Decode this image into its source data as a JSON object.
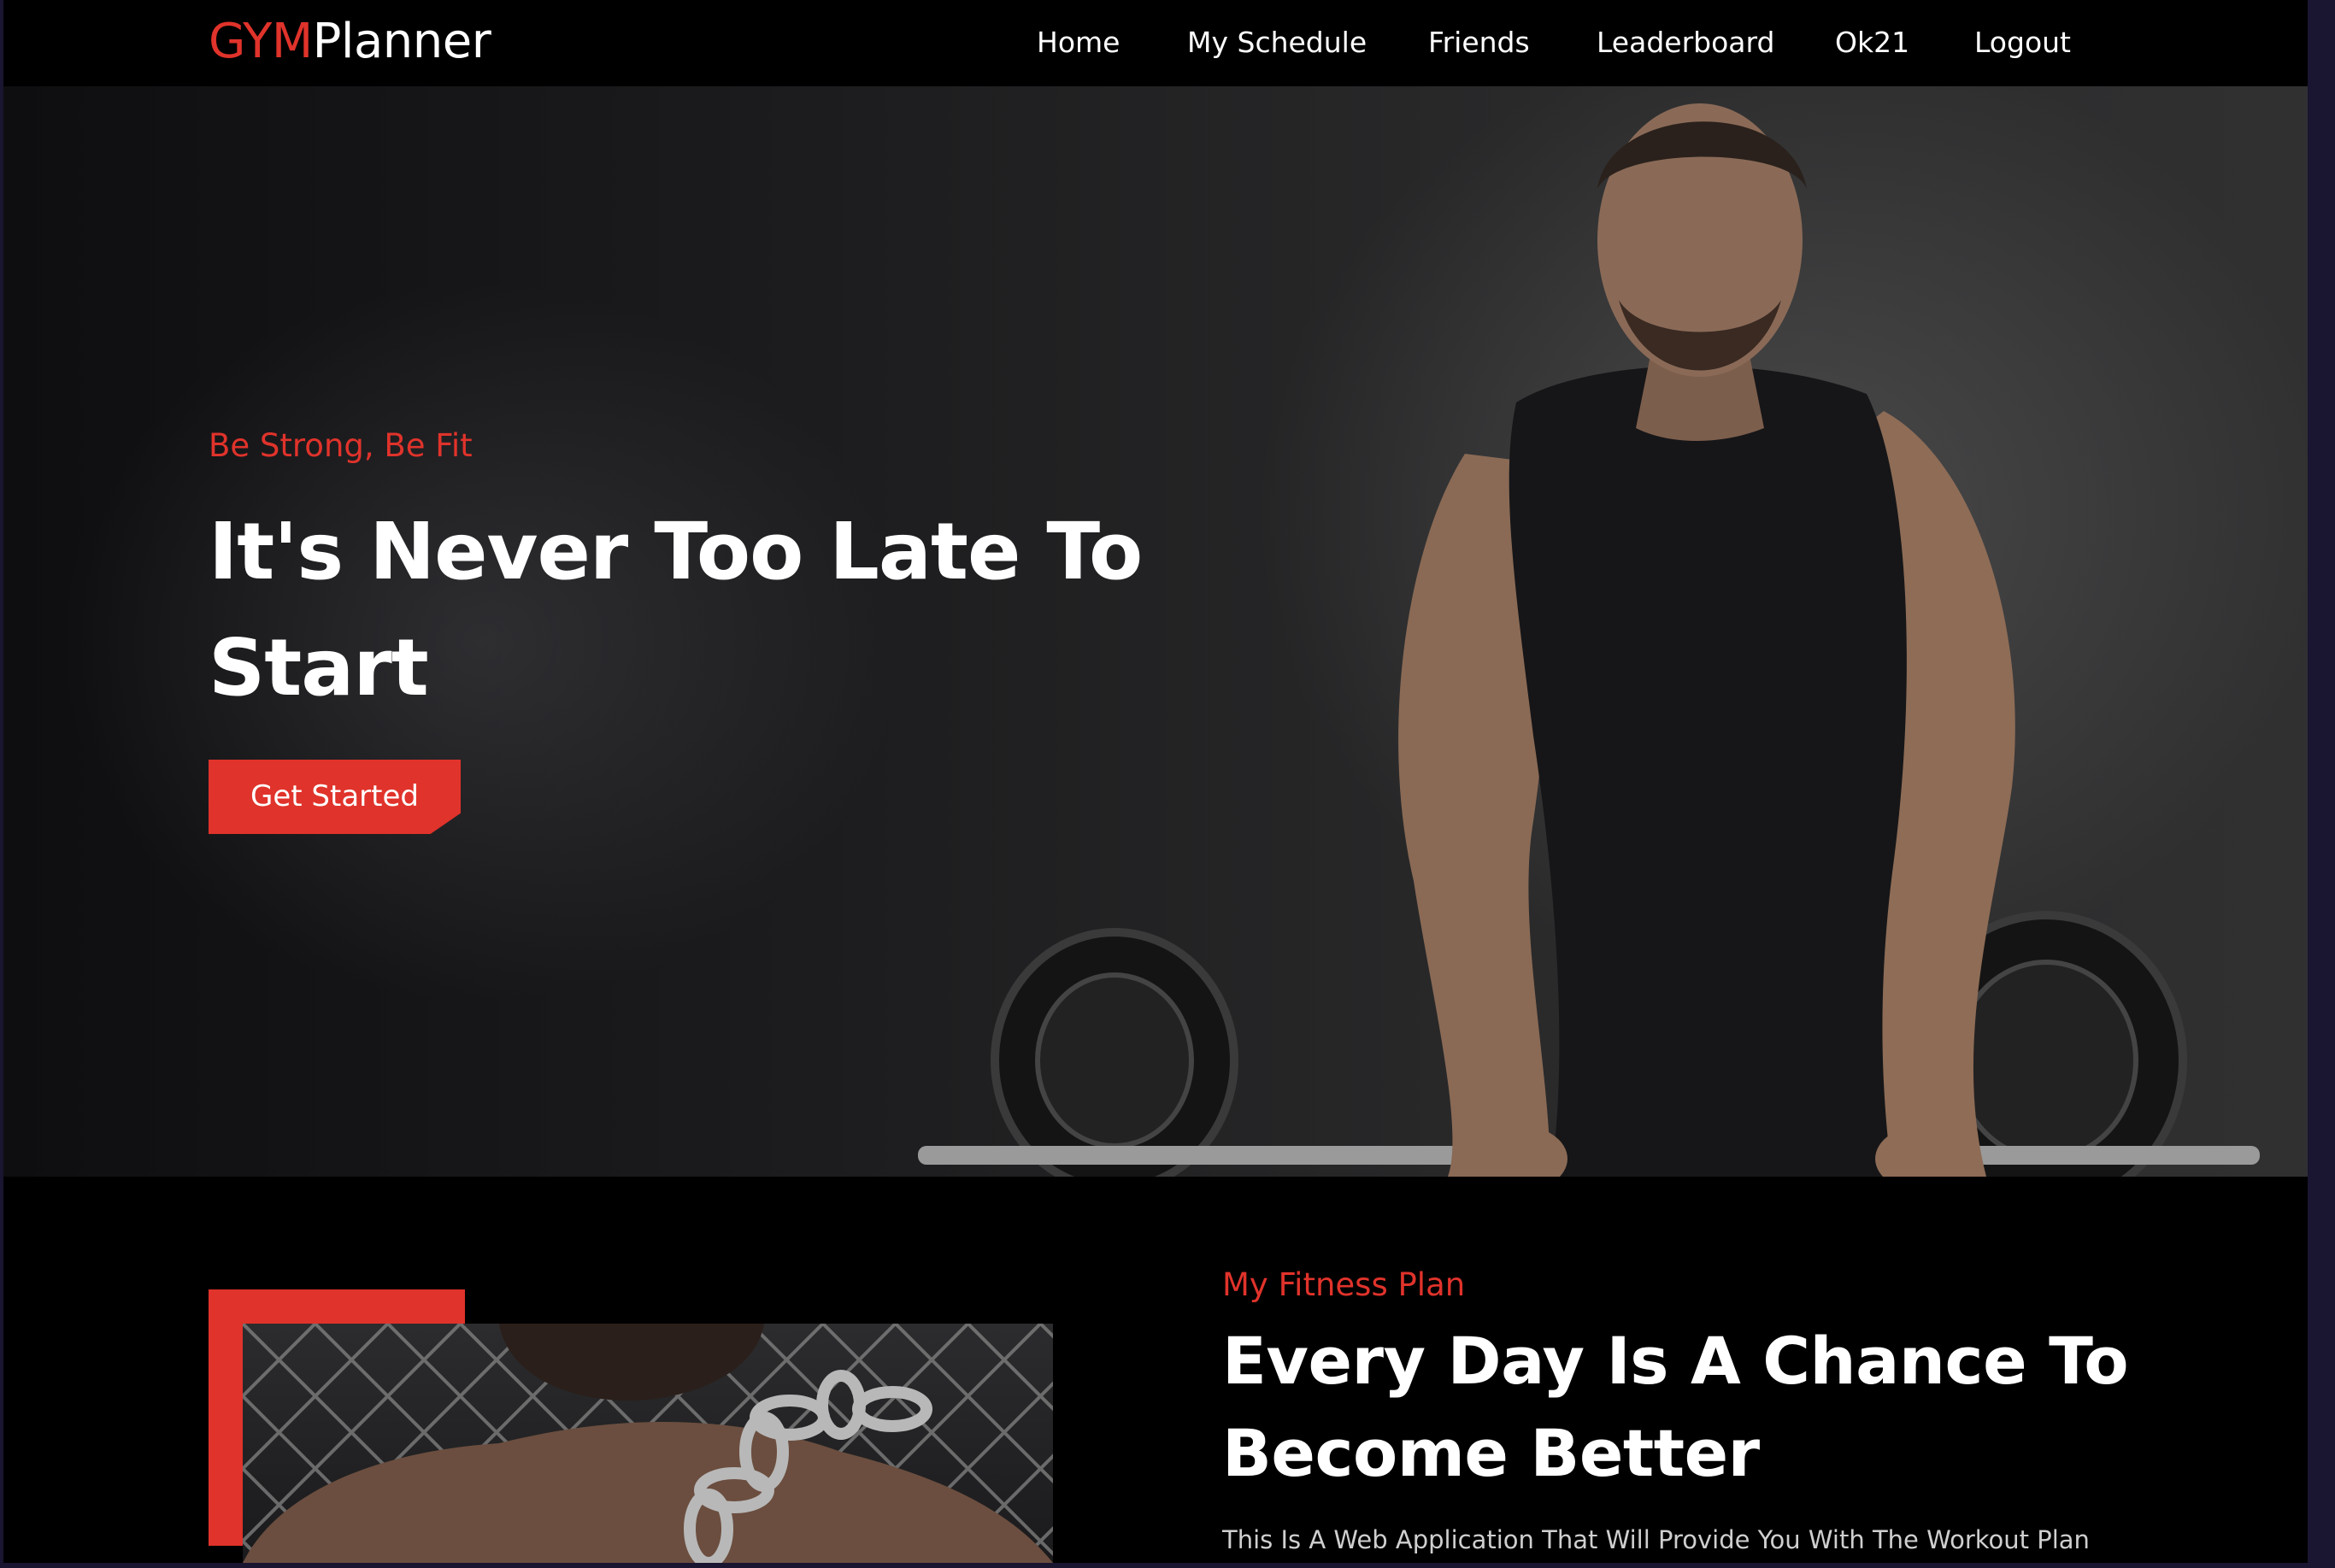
{
  "brand": {
    "accent": "GYM",
    "rest": "Planner"
  },
  "nav": {
    "items": [
      {
        "label": "Home"
      },
      {
        "label": "My Schedule"
      },
      {
        "label": "Friends"
      },
      {
        "label": "Leaderboard"
      },
      {
        "label": "Ok21"
      },
      {
        "label": "Logout"
      }
    ]
  },
  "hero": {
    "tagline": "Be Strong, Be Fit",
    "title": "It's Never Too Late To Start",
    "cta_label": "Get Started"
  },
  "about": {
    "tagline": "My Fitness Plan",
    "title": "Every Day Is A Chance To Become Better",
    "description": "This Is A Web Application That Will Provide You With The Workout Plan"
  },
  "colors": {
    "accent": "#e0332b",
    "background": "#000000",
    "text": "#ffffff"
  }
}
